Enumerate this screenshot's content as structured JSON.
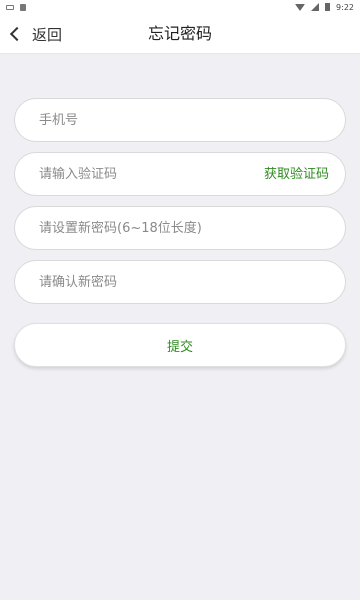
{
  "status_bar": {
    "time": "9:22",
    "left_icons": [
      "notification-icon",
      "download-icon"
    ],
    "right_icons": [
      "wifi-icon",
      "signal-icon",
      "battery-icon"
    ]
  },
  "nav": {
    "back_label": "返回",
    "title": "忘记密码"
  },
  "form": {
    "phone_placeholder": "手机号",
    "code_placeholder": "请输入验证码",
    "get_code_label": "获取验证码",
    "new_password_placeholder": "请设置新密码(6~18位长度)",
    "confirm_password_placeholder": "请确认新密码",
    "submit_label": "提交"
  },
  "colors": {
    "accent": "#2e8b1f",
    "background": "#efeff4",
    "surface": "#ffffff"
  }
}
